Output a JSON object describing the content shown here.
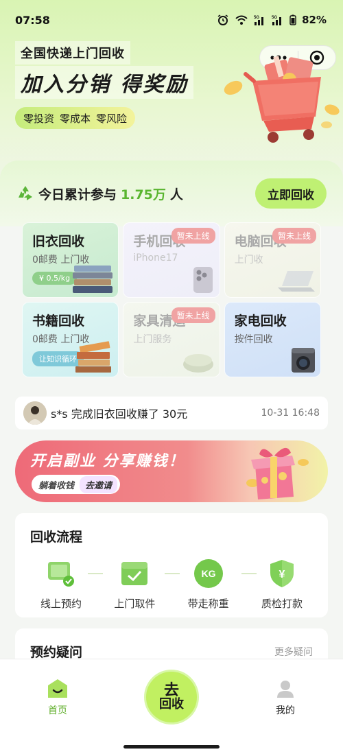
{
  "status_bar": {
    "time": "07:58",
    "battery": "82%",
    "signal_label": "5G"
  },
  "banner": {
    "line1": "全国快递上门回收",
    "line2": "加入分销 得奖励",
    "tags": [
      "零投资",
      "零成本",
      "零风险"
    ]
  },
  "capsule": {
    "menu_icon": "more-dots-icon",
    "close_icon": "target-circle-icon"
  },
  "stats": {
    "prefix": "今日累计参与",
    "number": "1.75万",
    "suffix": "人",
    "cta": "立即回收"
  },
  "categories": [
    {
      "title": "旧衣回收",
      "sub": "0邮费 上门收",
      "chip": "¥ 0.5/kg",
      "flag": "",
      "enabled": true
    },
    {
      "title": "手机回收",
      "sub": "iPhone17",
      "chip": "",
      "flag": "暂未上线",
      "enabled": false
    },
    {
      "title": "电脑回收",
      "sub": "上门收",
      "chip": "",
      "flag": "暂未上线",
      "enabled": false
    },
    {
      "title": "书籍回收",
      "sub": "0邮费 上门收",
      "chip": "让知识循环",
      "flag": "",
      "enabled": true
    },
    {
      "title": "家具清运",
      "sub": "上门服务",
      "chip": "",
      "flag": "暂未上线",
      "enabled": false
    },
    {
      "title": "家电回收",
      "sub": "按件回收",
      "chip": "",
      "flag": "",
      "enabled": true
    }
  ],
  "ticker": {
    "message": "s*s 完成旧衣回收赚了 30元",
    "time": "10-31 16:48"
  },
  "promo": {
    "title": "开启副业 分享赚钱！",
    "sub": "躺着收钱",
    "invite": "去邀请"
  },
  "process": {
    "title": "回收流程",
    "steps": [
      "线上预约",
      "上门取件",
      "带走称重",
      "质检打款"
    ],
    "kg_badge": "KG",
    "yen_badge": "¥"
  },
  "faq": {
    "title": "预约疑问",
    "more": "更多疑问"
  },
  "tabbar": {
    "home": "首页",
    "fab_line1": "去",
    "fab_line2": "回收",
    "mine": "我的",
    "accent": "#5fae2a"
  },
  "colors": {
    "brand_green": "#bff073",
    "stat_green": "#59b52f",
    "flag_red": "#f0a3a3"
  }
}
